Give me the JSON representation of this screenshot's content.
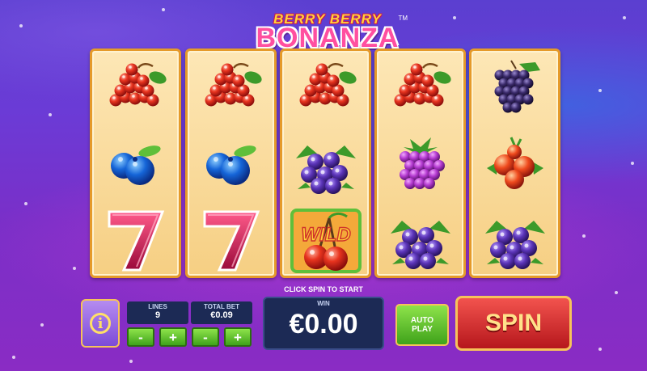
{
  "logo": {
    "line1": "BERRY BERRY",
    "line2": "BONANZA",
    "tm": "TM"
  },
  "reels": [
    [
      "redcurrant-icon",
      "blueberry-icon",
      "seven-icon"
    ],
    [
      "redcurrant-icon",
      "blueberry-icon",
      "seven-icon"
    ],
    [
      "redcurrant-icon",
      "blackcurrant-icon",
      "wild-cherry-icon"
    ],
    [
      "redcurrant-icon",
      "raspberry-icon",
      "blackcurrant-icon"
    ],
    [
      "blackberry-icon",
      "cranberry-icon",
      "blackcurrant-icon"
    ]
  ],
  "wild_label": "WILD",
  "controls": {
    "lines_label": "LINES",
    "lines_value": "9",
    "total_bet_label": "TOTAL BET",
    "total_bet_value": "€0.09",
    "minus": "-",
    "plus": "+",
    "info": "i",
    "message": "CLICK SPIN TO START",
    "win_label": "WIN",
    "win_value": "€0.00",
    "auto_play": "AUTO PLAY",
    "spin": "SPIN"
  },
  "colors": {
    "reel_frame": "#e59a2a",
    "button_green": "#3fa21b",
    "spin_red": "#b6171c",
    "panel_navy": "#1c2a55"
  }
}
